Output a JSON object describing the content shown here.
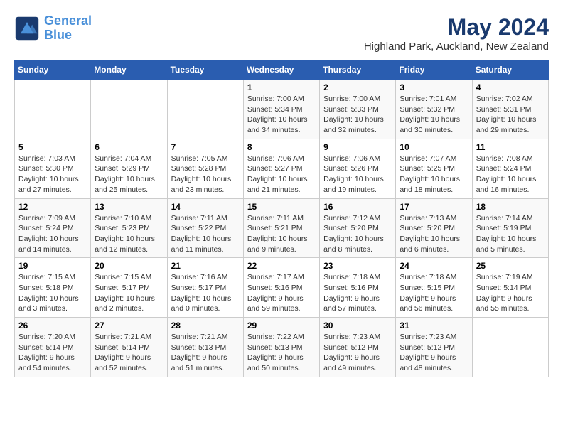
{
  "logo": {
    "line1": "General",
    "line2": "Blue"
  },
  "title": "May 2024",
  "subtitle": "Highland Park, Auckland, New Zealand",
  "days_of_week": [
    "Sunday",
    "Monday",
    "Tuesday",
    "Wednesday",
    "Thursday",
    "Friday",
    "Saturday"
  ],
  "weeks": [
    [
      {
        "day": "",
        "content": ""
      },
      {
        "day": "",
        "content": ""
      },
      {
        "day": "",
        "content": ""
      },
      {
        "day": "1",
        "content": "Sunrise: 7:00 AM\nSunset: 5:34 PM\nDaylight: 10 hours\nand 34 minutes."
      },
      {
        "day": "2",
        "content": "Sunrise: 7:00 AM\nSunset: 5:33 PM\nDaylight: 10 hours\nand 32 minutes."
      },
      {
        "day": "3",
        "content": "Sunrise: 7:01 AM\nSunset: 5:32 PM\nDaylight: 10 hours\nand 30 minutes."
      },
      {
        "day": "4",
        "content": "Sunrise: 7:02 AM\nSunset: 5:31 PM\nDaylight: 10 hours\nand 29 minutes."
      }
    ],
    [
      {
        "day": "5",
        "content": "Sunrise: 7:03 AM\nSunset: 5:30 PM\nDaylight: 10 hours\nand 27 minutes."
      },
      {
        "day": "6",
        "content": "Sunrise: 7:04 AM\nSunset: 5:29 PM\nDaylight: 10 hours\nand 25 minutes."
      },
      {
        "day": "7",
        "content": "Sunrise: 7:05 AM\nSunset: 5:28 PM\nDaylight: 10 hours\nand 23 minutes."
      },
      {
        "day": "8",
        "content": "Sunrise: 7:06 AM\nSunset: 5:27 PM\nDaylight: 10 hours\nand 21 minutes."
      },
      {
        "day": "9",
        "content": "Sunrise: 7:06 AM\nSunset: 5:26 PM\nDaylight: 10 hours\nand 19 minutes."
      },
      {
        "day": "10",
        "content": "Sunrise: 7:07 AM\nSunset: 5:25 PM\nDaylight: 10 hours\nand 18 minutes."
      },
      {
        "day": "11",
        "content": "Sunrise: 7:08 AM\nSunset: 5:24 PM\nDaylight: 10 hours\nand 16 minutes."
      }
    ],
    [
      {
        "day": "12",
        "content": "Sunrise: 7:09 AM\nSunset: 5:24 PM\nDaylight: 10 hours\nand 14 minutes."
      },
      {
        "day": "13",
        "content": "Sunrise: 7:10 AM\nSunset: 5:23 PM\nDaylight: 10 hours\nand 12 minutes."
      },
      {
        "day": "14",
        "content": "Sunrise: 7:11 AM\nSunset: 5:22 PM\nDaylight: 10 hours\nand 11 minutes."
      },
      {
        "day": "15",
        "content": "Sunrise: 7:11 AM\nSunset: 5:21 PM\nDaylight: 10 hours\nand 9 minutes."
      },
      {
        "day": "16",
        "content": "Sunrise: 7:12 AM\nSunset: 5:20 PM\nDaylight: 10 hours\nand 8 minutes."
      },
      {
        "day": "17",
        "content": "Sunrise: 7:13 AM\nSunset: 5:20 PM\nDaylight: 10 hours\nand 6 minutes."
      },
      {
        "day": "18",
        "content": "Sunrise: 7:14 AM\nSunset: 5:19 PM\nDaylight: 10 hours\nand 5 minutes."
      }
    ],
    [
      {
        "day": "19",
        "content": "Sunrise: 7:15 AM\nSunset: 5:18 PM\nDaylight: 10 hours\nand 3 minutes."
      },
      {
        "day": "20",
        "content": "Sunrise: 7:15 AM\nSunset: 5:17 PM\nDaylight: 10 hours\nand 2 minutes."
      },
      {
        "day": "21",
        "content": "Sunrise: 7:16 AM\nSunset: 5:17 PM\nDaylight: 10 hours\nand 0 minutes."
      },
      {
        "day": "22",
        "content": "Sunrise: 7:17 AM\nSunset: 5:16 PM\nDaylight: 9 hours\nand 59 minutes."
      },
      {
        "day": "23",
        "content": "Sunrise: 7:18 AM\nSunset: 5:16 PM\nDaylight: 9 hours\nand 57 minutes."
      },
      {
        "day": "24",
        "content": "Sunrise: 7:18 AM\nSunset: 5:15 PM\nDaylight: 9 hours\nand 56 minutes."
      },
      {
        "day": "25",
        "content": "Sunrise: 7:19 AM\nSunset: 5:14 PM\nDaylight: 9 hours\nand 55 minutes."
      }
    ],
    [
      {
        "day": "26",
        "content": "Sunrise: 7:20 AM\nSunset: 5:14 PM\nDaylight: 9 hours\nand 54 minutes."
      },
      {
        "day": "27",
        "content": "Sunrise: 7:21 AM\nSunset: 5:14 PM\nDaylight: 9 hours\nand 52 minutes."
      },
      {
        "day": "28",
        "content": "Sunrise: 7:21 AM\nSunset: 5:13 PM\nDaylight: 9 hours\nand 51 minutes."
      },
      {
        "day": "29",
        "content": "Sunrise: 7:22 AM\nSunset: 5:13 PM\nDaylight: 9 hours\nand 50 minutes."
      },
      {
        "day": "30",
        "content": "Sunrise: 7:23 AM\nSunset: 5:12 PM\nDaylight: 9 hours\nand 49 minutes."
      },
      {
        "day": "31",
        "content": "Sunrise: 7:23 AM\nSunset: 5:12 PM\nDaylight: 9 hours\nand 48 minutes."
      },
      {
        "day": "",
        "content": ""
      }
    ]
  ]
}
